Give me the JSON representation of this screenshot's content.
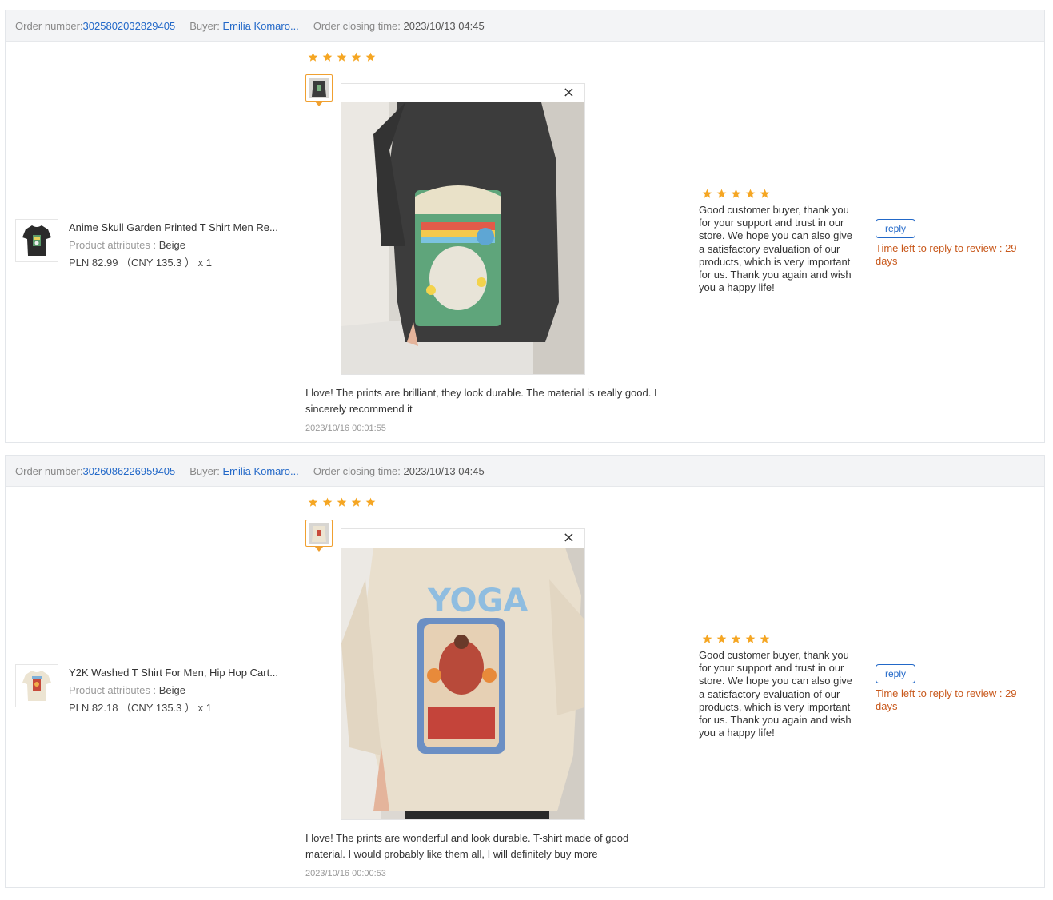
{
  "orders": [
    {
      "header": {
        "order_label": "Order number:",
        "order_number": "3025802032829405",
        "buyer_label": "Buyer:",
        "buyer_name": "Emilia Komaro...",
        "closing_label": "Order closing time:",
        "closing_time": "2023/10/13 04:45"
      },
      "product": {
        "name": "Anime Skull Garden Printed T Shirt Men Re...",
        "attr_label": "Product attributes :",
        "attr_value": "Beige",
        "price": "PLN 82.99 （CNY 135.3 ） x 1",
        "thumb_icon": "black-tshirt-thumbnail"
      },
      "review": {
        "rating": 5,
        "text": "I love! The prints are brilliant, they look durable. The material is really good. I sincerely recommend it",
        "date": "2023/10/16 00:01:55"
      },
      "seller_reply": {
        "rating": 5,
        "text": "Good customer buyer, thank you for your support and trust in our store. We hope you can also give a satisfactory evaluation of our products, which is very important for us. Thank you again and wish you a happy life!"
      },
      "reply_button": "reply",
      "time_left": "Time left to reply to review : 29 days"
    },
    {
      "header": {
        "order_label": "Order number:",
        "order_number": "3026086226959405",
        "buyer_label": "Buyer:",
        "buyer_name": "Emilia Komaro...",
        "closing_label": "Order closing time:",
        "closing_time": "2023/10/13 04:45"
      },
      "product": {
        "name": "Y2K Washed T Shirt For Men, Hip Hop Cart...",
        "attr_label": "Product attributes :",
        "attr_value": "Beige",
        "price": "PLN 82.18 （CNY 135.3 ） x 1",
        "thumb_icon": "beige-tshirt-thumbnail"
      },
      "review": {
        "rating": 5,
        "text": "I love! The prints are wonderful and look durable. T-shirt made of good material. I would probably like them all, I will definitely buy more",
        "date": "2023/10/16 00:00:53"
      },
      "seller_reply": {
        "rating": 5,
        "text": "Good customer buyer, thank you for your support and trust in our store. We hope you can also give a satisfactory evaluation of our products, which is very important for us. Thank you again and wish you a happy life!"
      },
      "reply_button": "reply",
      "time_left": "Time left to reply to review : 29 days"
    }
  ],
  "preview_close_icon": "×",
  "colors": {
    "star": "#f5a623",
    "link": "#2268c8",
    "time_left": "#c8581b",
    "mini_border": "#f0a030"
  }
}
